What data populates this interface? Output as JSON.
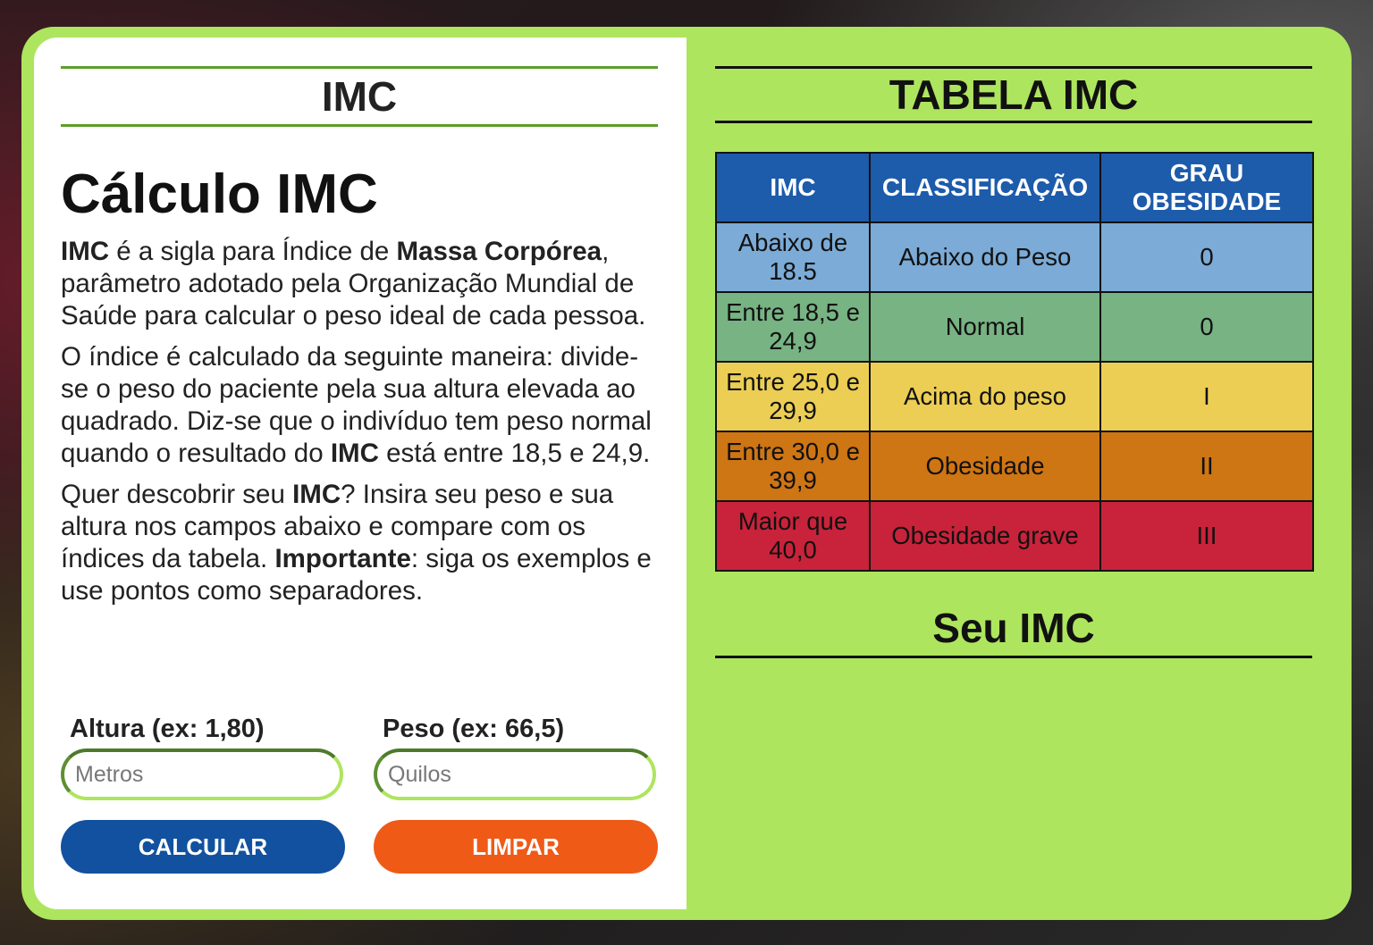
{
  "left": {
    "header": "IMC",
    "title": "Cálculo IMC",
    "paragraphs": {
      "p1": [
        "IMC",
        " é a sigla para Índice de ",
        "Massa Corpórea",
        ", parâmetro adotado pela Organização Mundial de Saúde para calcular o peso ideal de cada pessoa."
      ],
      "p2": [
        "O índice é calculado da seguinte maneira: divide-se o peso do paciente pela sua altura elevada ao quadrado. Diz-se que o indivíduo tem peso normal quando o resultado do ",
        "IMC",
        " está entre 18,5 e 24,9."
      ],
      "p3": [
        "Quer descobrir seu ",
        "IMC",
        "? Insira seu peso e sua altura nos campos abaixo e compare com os índices da tabela. ",
        "Importante",
        ": siga os exemplos e use pontos como separadores."
      ]
    },
    "form": {
      "height_label": "Altura (ex: 1,80)",
      "height_placeholder": "Metros",
      "height_value": "",
      "weight_label": "Peso (ex: 66,5)",
      "weight_placeholder": "Quilos",
      "weight_value": "",
      "calculate_label": "CALCULAR",
      "clear_label": "LIMPAR"
    }
  },
  "right": {
    "header": "TABELA IMC",
    "table": {
      "columns": [
        "IMC",
        "CLASSIFICAÇÃO",
        "GRAU\nOBESIDADE"
      ],
      "rows": [
        {
          "imc": "Abaixo de 18.5",
          "classification": "Abaixo do Peso",
          "grade": "0"
        },
        {
          "imc": "Entre 18,5 e 24,9",
          "classification": "Normal",
          "grade": "0"
        },
        {
          "imc": "Entre 25,0 e 29,9",
          "classification": "Acima do peso",
          "grade": "I"
        },
        {
          "imc": "Entre 30,0 e 39,9",
          "classification": "Obesidade",
          "grade": "II"
        },
        {
          "imc": "Maior que 40,0",
          "classification": "Obesidade grave",
          "grade": "III"
        }
      ]
    },
    "result_header": "Seu IMC"
  },
  "colors": {
    "card_bg": "#aee55e",
    "table_header": "#1d5bab",
    "row_underweight": "#7babd6",
    "row_normal": "#78b383",
    "row_overweight": "#ecce55",
    "row_obesity": "#ce7514",
    "row_severe": "#c8233a",
    "calculate_button": "#12519f",
    "clear_button": "#ef5a17"
  }
}
